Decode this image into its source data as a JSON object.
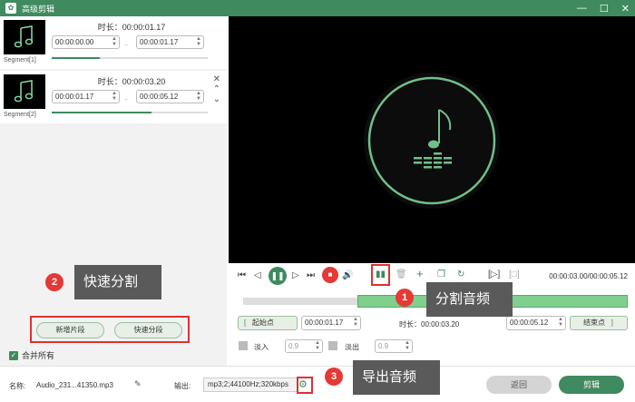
{
  "window": {
    "title": "高级剪辑",
    "logo": "logo-icon"
  },
  "segments": [
    {
      "label": "Segment[1]",
      "duration": "时长：00:00:01.17",
      "start": "00:00:00.00",
      "end": "00:00:01.17",
      "progress": 0.31
    },
    {
      "label": "Segment[2]",
      "duration": "时长：00:00:03.20",
      "start": "00:00:01.17",
      "end": "00:00:05.12",
      "progress": 0.64
    }
  ],
  "left_buttons": {
    "add_segment": "新增片段",
    "quick_split": "快速分段"
  },
  "merge_all": {
    "label": "合并所有",
    "checked": true
  },
  "annotations": {
    "a1": "分割音频",
    "a2": "快速分割",
    "a3": "导出音频",
    "n1": "1",
    "n2": "2",
    "n3": "3"
  },
  "player": {
    "time": "00:00:03.00/00:00:05.12"
  },
  "trim": {
    "start_btn": "起始点",
    "start_value": "00:00:01.17",
    "duration": "时长：00:00:03.20",
    "end_value": "00:00:05.12",
    "end_btn": "结束点"
  },
  "fade": {
    "fade_in_label": "淡入",
    "fade_in_value": "0.9",
    "fade_out_label": "淡出",
    "fade_out_value": "0.9"
  },
  "footer": {
    "name_label": "名称:",
    "name_value": "Audio_231...41350.mp3",
    "output_label": "输出:",
    "output_value": "mp3;2;44100Hz;320kbps",
    "back": "返回",
    "edit": "剪辑"
  },
  "colors": {
    "accent": "#3f8a5f",
    "annotation": "#e53935",
    "highlight_box": "#e03030"
  }
}
